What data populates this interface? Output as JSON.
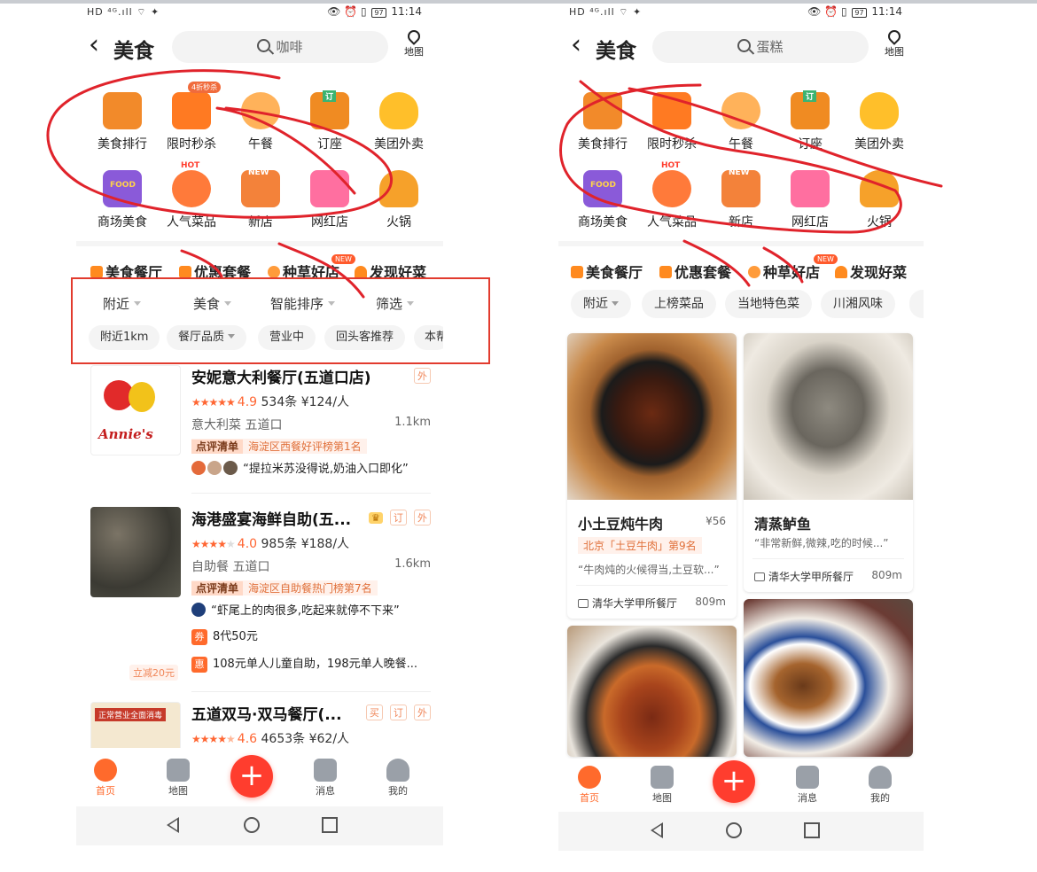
{
  "left": {
    "status": {
      "signal": "HD ⁴ᴳ.ıll ⌔ ✦",
      "icons": "👁 ⏰ ▯",
      "battery": "97",
      "time": "11:14"
    },
    "header": {
      "title": "美食",
      "search_placeholder": "咖啡",
      "map_label": "地图"
    },
    "categories": [
      {
        "label": "美食排行",
        "icon": "ranking-icon"
      },
      {
        "label": "限时秒杀",
        "icon": "flash-sale-icon",
        "tag": "4折秒杀"
      },
      {
        "label": "午餐",
        "icon": "lunch-icon"
      },
      {
        "label": "订座",
        "icon": "reservation-icon",
        "tag2": "订"
      },
      {
        "label": "美团外卖",
        "icon": "delivery-icon"
      },
      {
        "label": "商场美食",
        "icon": "mall-food-icon",
        "tag2": "FOOD"
      },
      {
        "label": "人气菜品",
        "icon": "popular-dish-icon",
        "tag2": "HOT"
      },
      {
        "label": "新店",
        "icon": "new-store-icon",
        "tag2": "NEW"
      },
      {
        "label": "网红店",
        "icon": "trendy-store-icon"
      },
      {
        "label": "火锅",
        "icon": "hotpot-icon"
      }
    ],
    "section_tabs": [
      "美食餐厅",
      "优惠套餐",
      "种草好店",
      "发现好菜"
    ],
    "new_badge": "NEW",
    "filters": [
      "附近",
      "美食",
      "智能排序",
      "筛选"
    ],
    "chips": [
      "附近1km",
      "餐厅品质",
      "营业中",
      "回头客推荐",
      "本帮"
    ],
    "restaurants": [
      {
        "name": "安妮意大利餐厅(五道口店)",
        "badges": [
          "外"
        ],
        "logo_text": "Annie's",
        "rating": "4.9",
        "reviews": "534条",
        "price": "¥124/人",
        "cuisine": "意大利菜",
        "area": "五道口",
        "distance": "1.1km",
        "rank_tag": "点评清单",
        "rank_text": "海淀区西餐好评榜第1名",
        "quote": "“提拉米苏没得说,奶油入口即化”"
      },
      {
        "name": "海港盛宴海鲜自助(五...",
        "badges": [
          "订",
          "外"
        ],
        "rating": "4.0",
        "reviews": "985条",
        "price": "¥188/人",
        "cuisine": "自助餐",
        "area": "五道口",
        "distance": "1.6km",
        "rank_tag": "点评清单",
        "rank_text": "海淀区自助餐热门榜第7名",
        "quote": "“虾尾上的肉很多,吃起来就停不下来”",
        "deal1_tag": "券",
        "deal1": "8代50元",
        "deal2_tag": "惠",
        "deal2": "108元单人儿童自助，198元单人晚餐...",
        "saving": "立减20元"
      },
      {
        "name": "五道双马·双马餐厅(...",
        "badges": [
          "买",
          "订",
          "外"
        ],
        "banner": "正常营业全面消毒",
        "rating": "4.6",
        "reviews": "4653条",
        "price": "¥62/人"
      }
    ],
    "nav": [
      "首页",
      "地图",
      "消息",
      "我的"
    ],
    "plus": "+"
  },
  "right": {
    "status": {
      "signal": "HD ⁴ᴳ.ıll ⌔ ✦",
      "icons": "👁 ⏰ ▯",
      "battery": "97",
      "time": "11:14"
    },
    "header": {
      "title": "美食",
      "search_placeholder": "蛋糕",
      "map_label": "地图"
    },
    "categories": [
      {
        "label": "美食排行",
        "icon": "ranking-icon"
      },
      {
        "label": "限时秒杀",
        "icon": "flash-sale-icon"
      },
      {
        "label": "午餐",
        "icon": "lunch-icon"
      },
      {
        "label": "订座",
        "icon": "reservation-icon",
        "tag2": "订"
      },
      {
        "label": "美团外卖",
        "icon": "delivery-icon"
      },
      {
        "label": "商场美食",
        "icon": "mall-food-icon",
        "tag2": "FOOD"
      },
      {
        "label": "人气菜品",
        "icon": "popular-dish-icon",
        "tag2": "HOT"
      },
      {
        "label": "新店",
        "icon": "new-store-icon",
        "tag2": "NEW"
      },
      {
        "label": "网红店",
        "icon": "trendy-store-icon"
      },
      {
        "label": "火锅",
        "icon": "hotpot-icon"
      }
    ],
    "section_tabs": [
      "美食餐厅",
      "优惠套餐",
      "种草好店",
      "发现好菜"
    ],
    "new_badge": "NEW",
    "pills": [
      "附近",
      "上榜菜品",
      "当地特色菜",
      "川湘风味"
    ],
    "cards": [
      {
        "title": "小土豆炖牛肉",
        "price": "¥56",
        "rank": "北京「土豆牛肉」第9名",
        "quote": "“牛肉炖的火候得当,土豆软...”",
        "shop": "清华大学甲所餐厅",
        "distance": "809m"
      },
      {
        "title": "清蒸鲈鱼",
        "quote": "“非常新鲜,微辣,吃的时候...”",
        "shop": "清华大学甲所餐厅",
        "distance": "809m"
      }
    ],
    "nav": [
      "首页",
      "地图",
      "消息",
      "我的"
    ],
    "plus": "+"
  },
  "colors": {
    "accent": "#ff6a2c",
    "plus_button": "#ff3d2e",
    "annotation_red": "#e0232b"
  }
}
